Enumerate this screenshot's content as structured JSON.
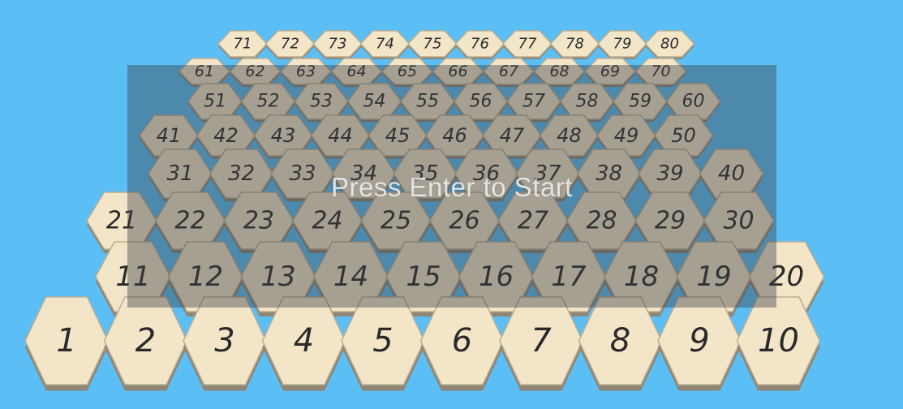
{
  "game": {
    "overlay_text": "Press Enter to Start",
    "background_color": "#5bbef5",
    "tile_color": "#f3e6c8",
    "overlay_color": "rgba(60,64,72,0.42)"
  },
  "board": {
    "rows": [
      [
        "1",
        "2",
        "3",
        "4",
        "5",
        "6",
        "7",
        "8",
        "9",
        "10"
      ],
      [
        "11",
        "12",
        "13",
        "14",
        "15",
        "16",
        "17",
        "18",
        "19",
        "20"
      ],
      [
        "21",
        "22",
        "23",
        "24",
        "25",
        "26",
        "27",
        "28",
        "29",
        "30"
      ],
      [
        "31",
        "32",
        "33",
        "34",
        "35",
        "36",
        "37",
        "38",
        "39",
        "40"
      ],
      [
        "41",
        "42",
        "43",
        "44",
        "45",
        "46",
        "47",
        "48",
        "49",
        "50"
      ],
      [
        "51",
        "52",
        "53",
        "54",
        "55",
        "56",
        "57",
        "58",
        "59",
        "60"
      ],
      [
        "61",
        "62",
        "63",
        "64",
        "65",
        "66",
        "67",
        "68",
        "69",
        "70"
      ],
      [
        "71",
        "72",
        "73",
        "74",
        "75",
        "76",
        "77",
        "78",
        "79",
        "80"
      ]
    ]
  }
}
